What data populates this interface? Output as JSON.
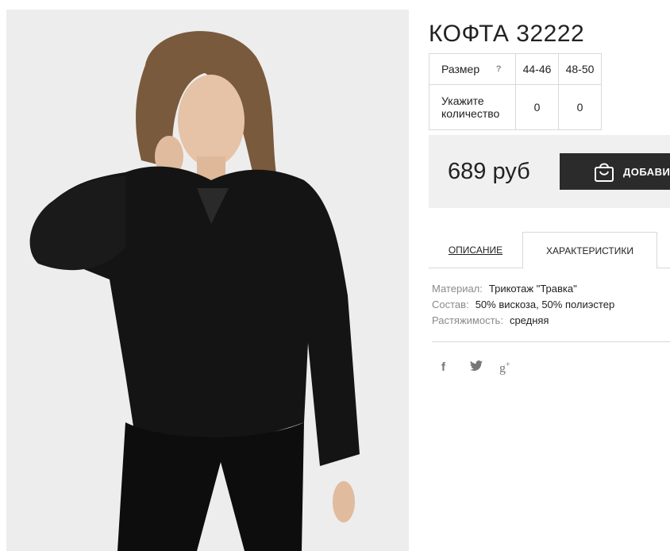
{
  "product": {
    "title": "КОФТА 32222",
    "photo_icon": "product-photo-woman-black-fluffy-sweater"
  },
  "size_table": {
    "size_label": "Размер",
    "help_glyph": "?",
    "sizes": [
      "44-46",
      "48-50"
    ],
    "quantity_label": "Укажите количество",
    "quantities": [
      "0",
      "0"
    ]
  },
  "purchase": {
    "price": "689 руб",
    "cart_button_label": "ДОБАВИТ",
    "cart_icon": "shopping-bag-icon",
    "button_color": "#2b2b2b"
  },
  "tabs": {
    "description": "ОПИСАНИЕ",
    "characteristics": "ХАРАКТЕРИСТИКИ",
    "active": "characteristics"
  },
  "specs": [
    {
      "key": "Материал:",
      "value": "Трикотаж \"Травка\""
    },
    {
      "key": "Состав:",
      "value": "50% вискоза, 50% полиэстер"
    },
    {
      "key": "Растяжимость:",
      "value": "средняя"
    }
  ],
  "social": {
    "facebook_glyph": "f",
    "twitter_icon": "twitter-bird-icon",
    "gplus_glyph": "g",
    "gplus_sup": "+"
  }
}
